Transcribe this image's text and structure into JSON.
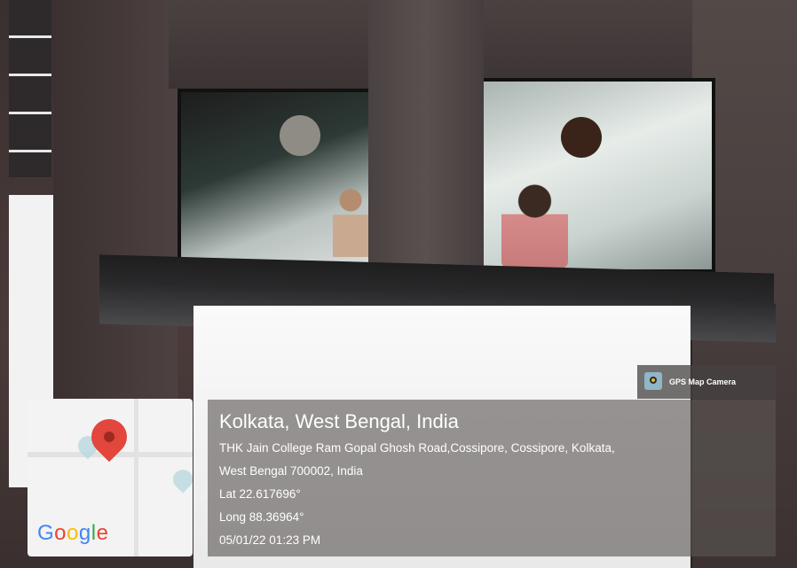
{
  "watermark": {
    "app_name": "GPS Map Camera",
    "icon": "gps-map-camera-icon"
  },
  "location": {
    "title": "Kolkata, West Bengal, India",
    "address_line1": "THK Jain College Ram Gopal Ghosh Road,Cossipore, Cossipore, Kolkata,",
    "address_line2": "West Bengal 700002, India",
    "latitude": "Lat 22.617696°",
    "longitude": "Long 88.36964°",
    "datetime": "05/01/22 01:23 PM"
  },
  "map": {
    "logo_text": "Google",
    "pin_icon": "map-pin-icon",
    "pin_color": "#e2463c"
  }
}
